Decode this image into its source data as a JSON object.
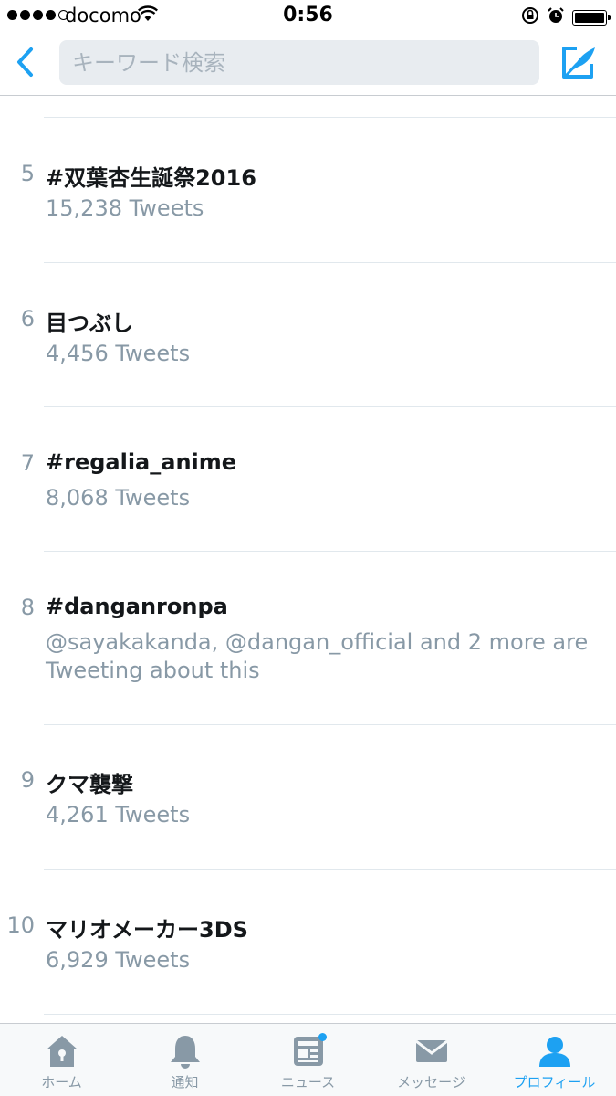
{
  "status_bar": {
    "carrier": "docomo",
    "time": "0:56",
    "signal_strength": 4,
    "signal_max": 5,
    "battery_level": 1.0
  },
  "navbar": {
    "search_placeholder": "キーワード検索",
    "back_icon": "chevron-left-icon",
    "compose_icon": "compose-icon",
    "accent_color": "#1da1f2"
  },
  "trends": [
    {
      "rank": "5",
      "topic": "#双葉杏生誕祭2016",
      "meta": "15,238 Tweets"
    },
    {
      "rank": "6",
      "topic": "目つぶし",
      "meta": "4,456 Tweets"
    },
    {
      "rank": "7",
      "topic": "#regalia_anime",
      "meta": "8,068 Tweets"
    },
    {
      "rank": "8",
      "topic": "#danganronpa",
      "meta": "@sayakakanda, @dangan_official and 2 more are Tweeting about this"
    },
    {
      "rank": "9",
      "topic": "クマ襲撃",
      "meta": "4,261 Tweets"
    },
    {
      "rank": "10",
      "topic": "マリオメーカー3DS",
      "meta": "6,929 Tweets"
    }
  ],
  "tabbar": {
    "tabs": [
      {
        "label": "ホーム",
        "icon": "home-icon",
        "active": false
      },
      {
        "label": "通知",
        "icon": "bell-icon",
        "active": false
      },
      {
        "label": "ニュース",
        "icon": "news-icon",
        "active": false,
        "badge": true
      },
      {
        "label": "メッセージ",
        "icon": "envelope-icon",
        "active": false
      },
      {
        "label": "プロフィール",
        "icon": "person-icon",
        "active": true
      }
    ]
  }
}
